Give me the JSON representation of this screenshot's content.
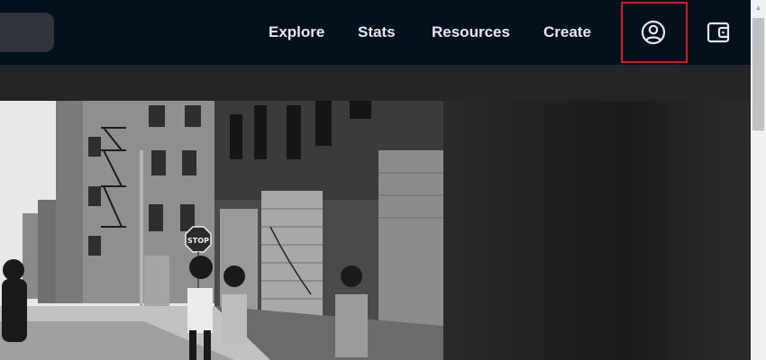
{
  "nav": {
    "links": [
      "Explore",
      "Stats",
      "Resources",
      "Create"
    ],
    "icons": {
      "profile": "user-circle-icon",
      "wallet": "wallet-icon"
    }
  },
  "colors": {
    "nav_bg": "#04111d",
    "nav_text": "#e5e8eb",
    "highlight": "#e0141e",
    "page_bg": "#1e1f21"
  },
  "hero": {
    "sign_text": "STOP"
  }
}
